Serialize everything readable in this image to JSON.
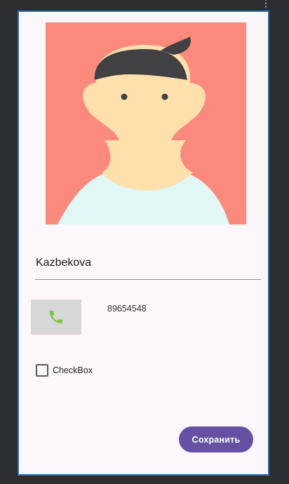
{
  "contact": {
    "name": "Kazbekova",
    "phone_number": "89654548"
  },
  "call_button": {
    "icon": "phone-icon",
    "icon_color": "#7cc43b"
  },
  "checkbox": {
    "label": "CheckBox",
    "checked": false
  },
  "save_button": {
    "label": "Сохранить",
    "color": "#6650a4"
  },
  "avatar": {
    "background_color": "#fb8a7d",
    "hair_color": "#414042",
    "skin_color": "#fde0ac",
    "shirt_color": "#e0f7f6"
  },
  "toolbar": {
    "overflow_icon": "more-vert-icon"
  }
}
